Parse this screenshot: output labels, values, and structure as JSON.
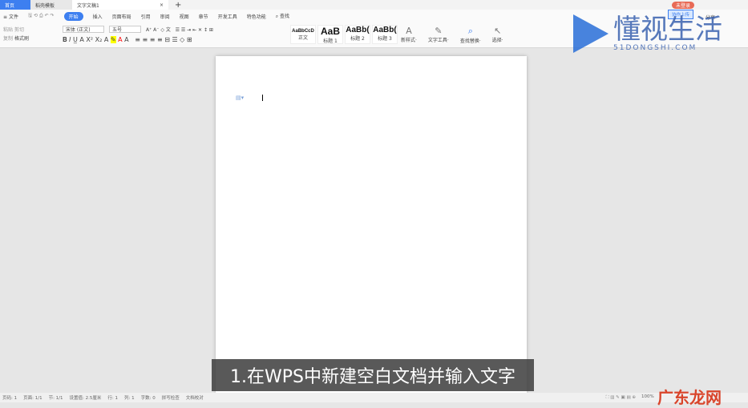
{
  "tabs": [
    "首页",
    "稻壳模板",
    "文字文稿1"
  ],
  "menu": {
    "file": "文件",
    "items": [
      "开始",
      "插入",
      "页面布局",
      "引用",
      "审阅",
      "视图",
      "章节",
      "开发工具",
      "特色功能"
    ],
    "search": "查找"
  },
  "ribbon": {
    "font": "宋体 (正文)",
    "size": "五号",
    "cut": "剪切",
    "copy": "复制",
    "paste": "粘贴",
    "format_painter": "格式刷",
    "styles": [
      {
        "preview": "AaBbCcD",
        "label": "正文"
      },
      {
        "preview": "AaB",
        "label": "标题 1"
      },
      {
        "preview": "AaBb(",
        "label": "标题 2"
      },
      {
        "preview": "AaBb(",
        "label": "标题 3"
      }
    ],
    "tools": [
      {
        "icon": "A",
        "label": "新样式·"
      },
      {
        "icon": "✎",
        "label": "文字工具·"
      },
      {
        "icon": "⌕",
        "label": "查找替换·"
      },
      {
        "icon": "↖",
        "label": "选择·"
      }
    ]
  },
  "account": {
    "login": "未登录",
    "upload": "协作上传",
    "share": "分享"
  },
  "caption": "1.在WPS中新建空白文档并输入文字",
  "status": [
    "页码: 1",
    "页面: 1/1",
    "节: 1/1",
    "设置值: 2.5厘米",
    "行: 1",
    "列: 1",
    "字数: 0",
    "拼写检查",
    "文档校对"
  ],
  "zoom": "100%",
  "watermark": {
    "title": "懂视生活",
    "site": "51DONGSHI.COM",
    "corner": "广东龙网"
  }
}
